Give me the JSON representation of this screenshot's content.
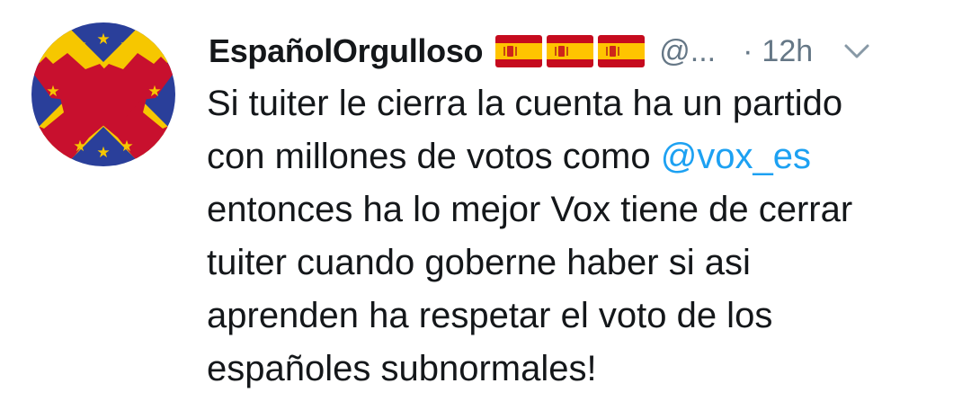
{
  "tweet": {
    "display_name": "EspañolOrgulloso",
    "flags": [
      "spain-flag",
      "spain-flag",
      "spain-flag"
    ],
    "handle": "@...",
    "separator": "·",
    "time": "12h",
    "text": {
      "line1": "Si tuiter le cierra la cuenta ha un partido",
      "line2_pre": "con millones de votos como ",
      "mention": "@vox_es",
      "line3": "entonces ha lo mejor Vox tiene de cerrar",
      "line4": "tuiter cuando goberne haber si asi",
      "line5": "aprenden ha respetar el voto de los",
      "line6": "españoles subnormales!"
    }
  },
  "colors": {
    "text": "#14171a",
    "secondary": "#657786",
    "link": "#1da1f2",
    "avatar_blue": "#2a3f9a",
    "avatar_yellow": "#f6c700",
    "cross_red": "#c8102e",
    "flag_red": "#c60b1e",
    "flag_yellow": "#ffc400"
  },
  "icons": {
    "avatar": "burgundy-cross-eu-stars-avatar",
    "menu": "chevron-down-icon"
  }
}
